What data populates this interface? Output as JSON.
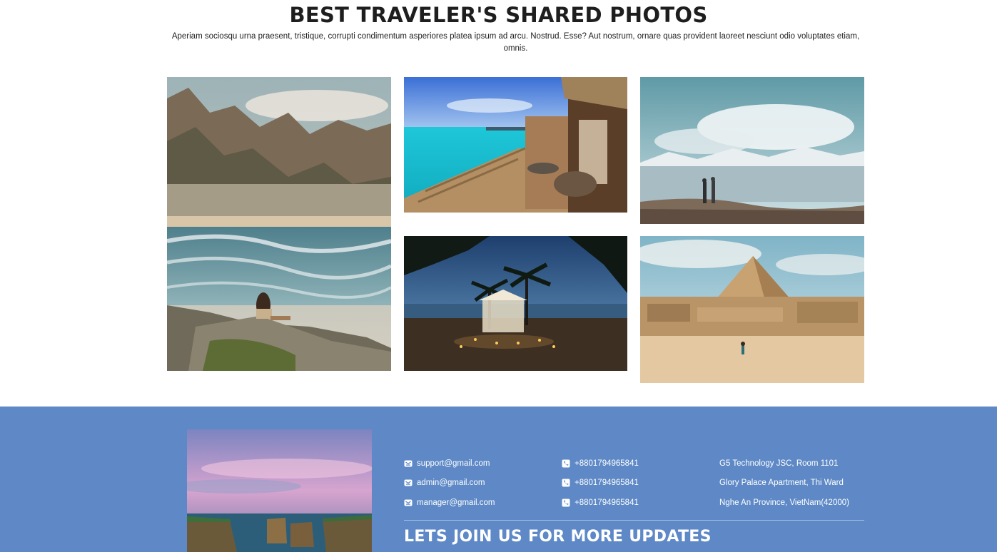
{
  "gallery": {
    "title": "BEST TRAVELER'S SHARED PHOTOS",
    "subtitle": "Aperiam sociosqu urna praesent, tristique, corrupti condimentum asperiores platea ipsum ad arcu. Nostrud. Esse? Aut nostrum, ornare quas provident laoreet nesciunt odio voluptates etiam, omnis."
  },
  "footer": {
    "emails": [
      "support@gmail.com",
      "admin@gmail.com",
      "manager@gmail.com"
    ],
    "phones": [
      "+8801794965841",
      "+8801794965841",
      "+8801794965841"
    ],
    "address": [
      "G5 Technology JSC, Room 1101",
      "Glory Palace Apartment, Thi Ward",
      "Nghe An Province, VietNam(42000)"
    ],
    "join_title": "LETS JOIN US FOR MORE UPDATES"
  },
  "icons": {
    "email": "envelope-icon",
    "phone": "phone-icon"
  },
  "colors": {
    "footer_bg": "#5e89c6",
    "text_white": "#ffffff",
    "title": "#1e1e1e"
  }
}
